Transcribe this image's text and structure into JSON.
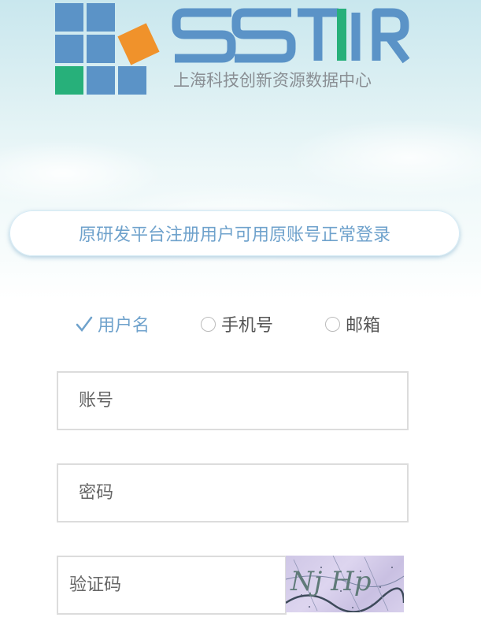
{
  "brand": {
    "logo_letters": "SSTIR",
    "org_name": "上海科技创新资源数据中心"
  },
  "notice": {
    "text": "原研发平台注册用户可用原账号正常登录"
  },
  "login_types": [
    {
      "label": "用户名",
      "selected": true
    },
    {
      "label": "手机号",
      "selected": false
    },
    {
      "label": "邮箱",
      "selected": false
    }
  ],
  "form": {
    "account_placeholder": "账号",
    "password_placeholder": "密码",
    "captcha_placeholder": "验证码",
    "captcha_text": "Nj Hp"
  },
  "colors": {
    "accent": "#6fa2cc",
    "logo_blue": "#5b93c7",
    "logo_orange": "#f0922b",
    "logo_green": "#27b07a"
  }
}
